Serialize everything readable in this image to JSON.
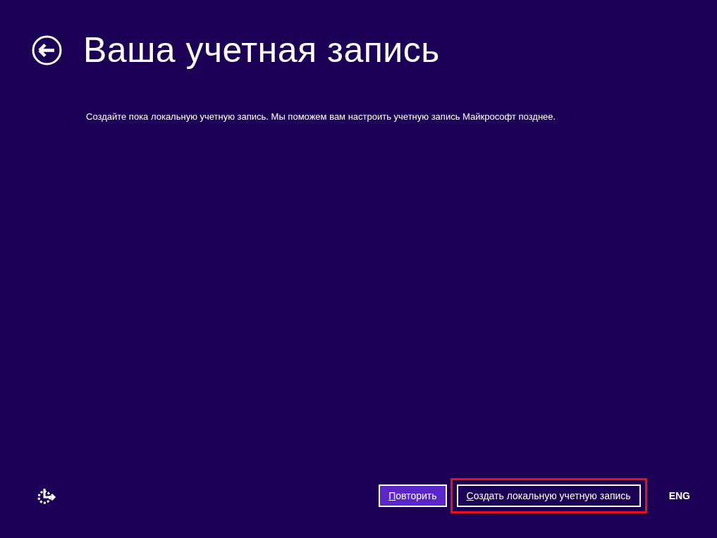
{
  "header": {
    "title": "Ваша учетная запись"
  },
  "message": "Создайте пока локальную учетную запись. Мы поможем вам настроить учетную запись Майкрософт позднее.",
  "buttons": [
    {
      "label": "Повторить",
      "kind": "primary",
      "highlighted": false
    },
    {
      "label": "Создать локальную учетную запись",
      "kind": "secondary",
      "highlighted": true
    }
  ],
  "language": "ENG"
}
